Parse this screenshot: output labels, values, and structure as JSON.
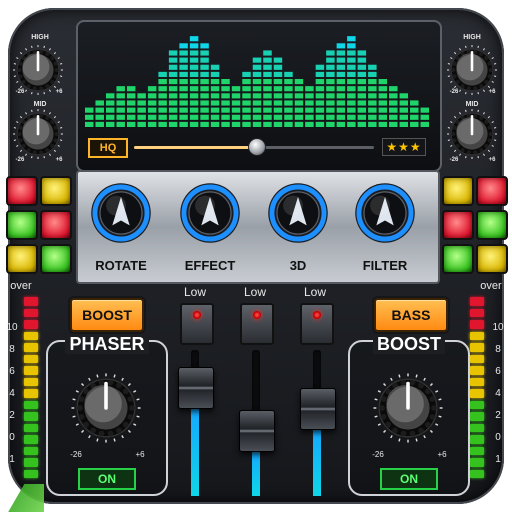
{
  "app": {
    "knobs": {
      "high": "HIGH",
      "mid": "MID",
      "min": "-26",
      "max": "+6"
    },
    "screen": {
      "badge": "HQ",
      "stars": "★★★"
    },
    "effects": [
      {
        "label": "ROTATE"
      },
      {
        "label": "EFFECT"
      },
      {
        "label": "3D"
      },
      {
        "label": "FILTER"
      }
    ],
    "vu": {
      "over": "over",
      "scale": [
        "10",
        "8",
        "6",
        "4",
        "2",
        "0",
        "1"
      ]
    },
    "buttons": {
      "boost": "BOOST",
      "bass": "BASS"
    },
    "low_label": "Low",
    "phaser": {
      "title": "PHASER",
      "min": "-26",
      "max": "+6",
      "on": "ON"
    },
    "boost_panel": {
      "title": "BOOST",
      "min": "-26",
      "max": "+6",
      "on": "ON"
    },
    "eq_bars": [
      3,
      4,
      5,
      6,
      6,
      5,
      6,
      8,
      11,
      12,
      13,
      12,
      9,
      7,
      6,
      8,
      10,
      11,
      10,
      8,
      7,
      6,
      9,
      11,
      12,
      13,
      11,
      9,
      7,
      6,
      5,
      4,
      3
    ],
    "seek_position": 0.51,
    "sliders": [
      0.75,
      0.45,
      0.6
    ],
    "colors": {
      "accent": "#ff9a1f",
      "on": "#28d14a",
      "eq_top": "#0fd6e8",
      "eq_bottom": "#1fd46a"
    }
  }
}
